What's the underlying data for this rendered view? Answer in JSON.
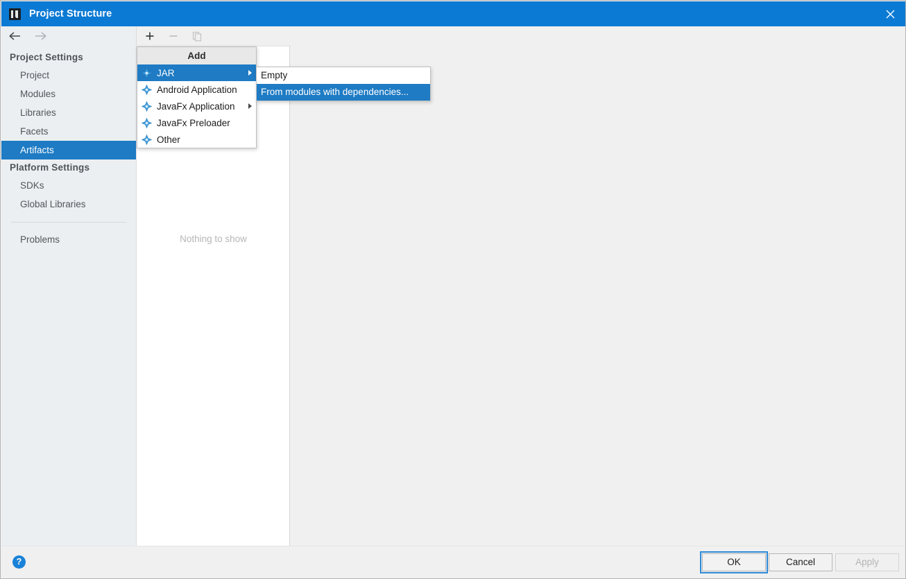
{
  "window": {
    "title": "Project Structure",
    "app_icon": "intellij-idea-icon",
    "close_icon": "close-icon",
    "titlebar_color": "#0b7ad4"
  },
  "nav": {
    "back_icon": "arrow-left-icon",
    "forward_icon": "arrow-right-icon"
  },
  "sidebar": {
    "groups": [
      {
        "title": "Project Settings",
        "items": [
          {
            "label": "Project",
            "selected": false
          },
          {
            "label": "Modules",
            "selected": false
          },
          {
            "label": "Libraries",
            "selected": false
          },
          {
            "label": "Facets",
            "selected": false
          },
          {
            "label": "Artifacts",
            "selected": true
          }
        ]
      },
      {
        "title": "Platform Settings",
        "items": [
          {
            "label": "SDKs",
            "selected": false
          },
          {
            "label": "Global Libraries",
            "selected": false
          }
        ]
      }
    ],
    "footer_items": [
      {
        "label": "Problems",
        "selected": false
      }
    ],
    "selected_color": "#1e7bc4"
  },
  "toolbar": {
    "add_icon": "plus-icon",
    "remove_icon": "minus-icon",
    "copy_icon": "copy-icon",
    "add_enabled": true,
    "remove_enabled": false,
    "copy_enabled": false
  },
  "artifact_list": {
    "empty_message": "Nothing to show"
  },
  "add_menu": {
    "header": "Add",
    "items": [
      {
        "label": "JAR",
        "icon": "artifact-diamond-icon",
        "has_submenu": true,
        "highlighted": true
      },
      {
        "label": "Android Application",
        "icon": "artifact-diamond-icon",
        "has_submenu": false,
        "highlighted": false
      },
      {
        "label": "JavaFx Application",
        "icon": "artifact-diamond-icon",
        "has_submenu": true,
        "highlighted": false
      },
      {
        "label": "JavaFx Preloader",
        "icon": "artifact-diamond-icon",
        "has_submenu": false,
        "highlighted": false
      },
      {
        "label": "Other",
        "icon": "artifact-diamond-icon",
        "has_submenu": false,
        "highlighted": false
      }
    ]
  },
  "jar_submenu": {
    "items": [
      {
        "label": "Empty",
        "highlighted": false
      },
      {
        "label": "From modules with dependencies...",
        "highlighted": true
      }
    ]
  },
  "footer": {
    "help_icon": "help-question-icon",
    "help_label": "?",
    "buttons": [
      {
        "name": "ok",
        "label": "OK",
        "enabled": true,
        "focused": true
      },
      {
        "name": "cancel",
        "label": "Cancel",
        "enabled": true,
        "focused": false
      },
      {
        "name": "apply",
        "label": "Apply",
        "enabled": false,
        "focused": false
      }
    ]
  }
}
